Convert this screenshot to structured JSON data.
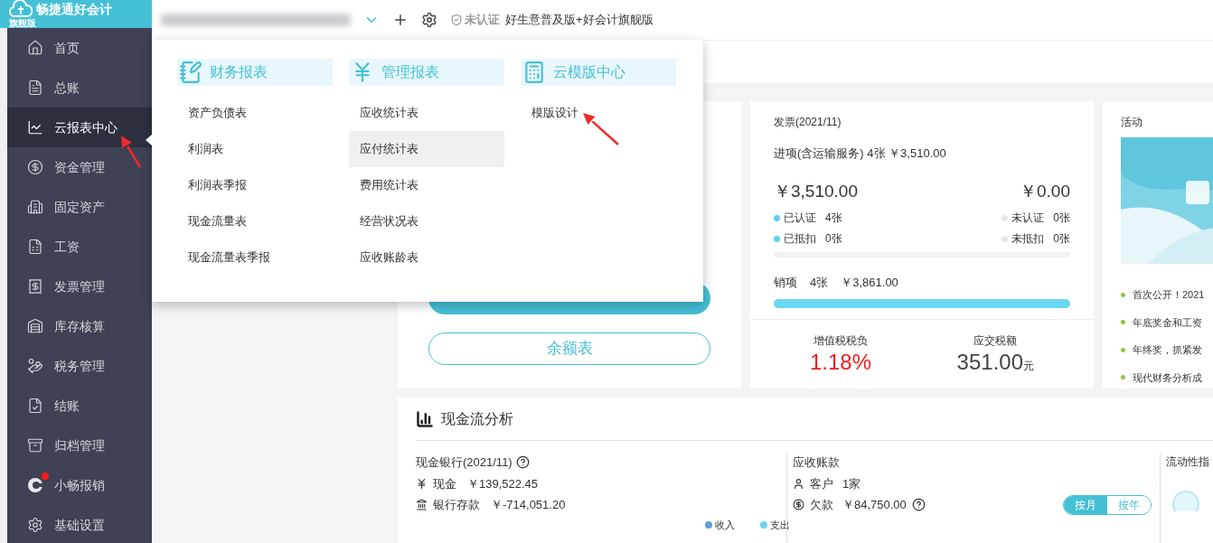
{
  "brand": {
    "name": "畅捷通好会计",
    "edition": "旗舰版"
  },
  "sidebar": {
    "items": [
      {
        "label": "首页",
        "selected": false,
        "badge": false
      },
      {
        "label": "总账",
        "selected": false,
        "badge": false
      },
      {
        "label": "云报表中心",
        "selected": true,
        "badge": false
      },
      {
        "label": "资金管理",
        "selected": false,
        "badge": false
      },
      {
        "label": "固定资产",
        "selected": false,
        "badge": false
      },
      {
        "label": "工资",
        "selected": false,
        "badge": false
      },
      {
        "label": "发票管理",
        "selected": false,
        "badge": false
      },
      {
        "label": "库存核算",
        "selected": false,
        "badge": false
      },
      {
        "label": "税务管理",
        "selected": false,
        "badge": false
      },
      {
        "label": "结账",
        "selected": false,
        "badge": false
      },
      {
        "label": "归档管理",
        "selected": false,
        "badge": false
      },
      {
        "label": "小畅报销",
        "selected": false,
        "badge": true
      },
      {
        "label": "基础设置",
        "selected": false,
        "badge": false
      }
    ]
  },
  "topbar": {
    "verify_status": "未认证",
    "product": "好生意普及版+好会计旗舰版"
  },
  "dropdown": {
    "columns": [
      {
        "title": "财务报表",
        "items": [
          {
            "label": "资产负债表",
            "highlighted": false
          },
          {
            "label": "利润表",
            "highlighted": false
          },
          {
            "label": "利润表季报",
            "highlighted": false
          },
          {
            "label": "现金流量表",
            "highlighted": false
          },
          {
            "label": "现金流量表季报",
            "highlighted": false
          }
        ]
      },
      {
        "title": "管理报表",
        "items": [
          {
            "label": "应收统计表",
            "highlighted": false
          },
          {
            "label": "应付统计表",
            "highlighted": true
          },
          {
            "label": "费用统计表",
            "highlighted": false
          },
          {
            "label": "经营状况表",
            "highlighted": false
          },
          {
            "label": "应收账龄表",
            "highlighted": false
          }
        ]
      },
      {
        "title": "云模版中心",
        "items": [
          {
            "label": "模版设计",
            "highlighted": false
          }
        ]
      }
    ]
  },
  "report_card": {
    "outline_button": "余额表"
  },
  "invoice_card": {
    "title": "发票(2021/11)",
    "input_line": "进项(含运输服务) 4张 ￥3,510.00",
    "amounts": [
      "￥3,510.00",
      "￥0.00"
    ],
    "statuses": [
      [
        {
          "label": "已认证",
          "count": "4张",
          "color": "#5fd0ef"
        },
        {
          "label": "已抵扣",
          "count": "0张",
          "color": "#5fd0ef"
        }
      ],
      [
        {
          "label": "未认证",
          "count": "0张",
          "color": "#e6e6e6"
        },
        {
          "label": "未抵扣",
          "count": "0张",
          "color": "#e6e6e6"
        }
      ]
    ],
    "output": {
      "label": "销项",
      "count": "4张",
      "amount": "￥3,861.00",
      "level": 1
    },
    "tax_burden": {
      "label": "增值税税负",
      "value": "1.18%"
    },
    "tax_payable": {
      "label": "应交税额",
      "value": "351.00",
      "unit": "元"
    }
  },
  "activity_card": {
    "title": "活动",
    "items": [
      "首次公开！2021",
      "年底奖金和工资",
      "年终奖，抓紧发",
      "现代财务分析成"
    ]
  },
  "cashflow": {
    "title": "现金流分析",
    "bank": {
      "title": "现金银行(2021/11)",
      "rows": [
        {
          "label": "现金",
          "value": "￥139,522.45"
        },
        {
          "label": "银行存款",
          "value": "￥-714,051.20"
        }
      ],
      "legend": [
        {
          "label": "收入",
          "color": "#5a9fd8"
        },
        {
          "label": "支出",
          "color": "#6dd3f0"
        }
      ]
    },
    "receivable": {
      "title": "应收账款",
      "rows": [
        {
          "label": "客户",
          "value": "1家",
          "help": false
        },
        {
          "label": "欠款",
          "value": "￥84,750.00",
          "help": true
        }
      ],
      "toggle": [
        {
          "label": "按月",
          "selected": true
        },
        {
          "label": "按年",
          "selected": false
        }
      ]
    },
    "liquidity": {
      "title": "流动性指"
    }
  }
}
